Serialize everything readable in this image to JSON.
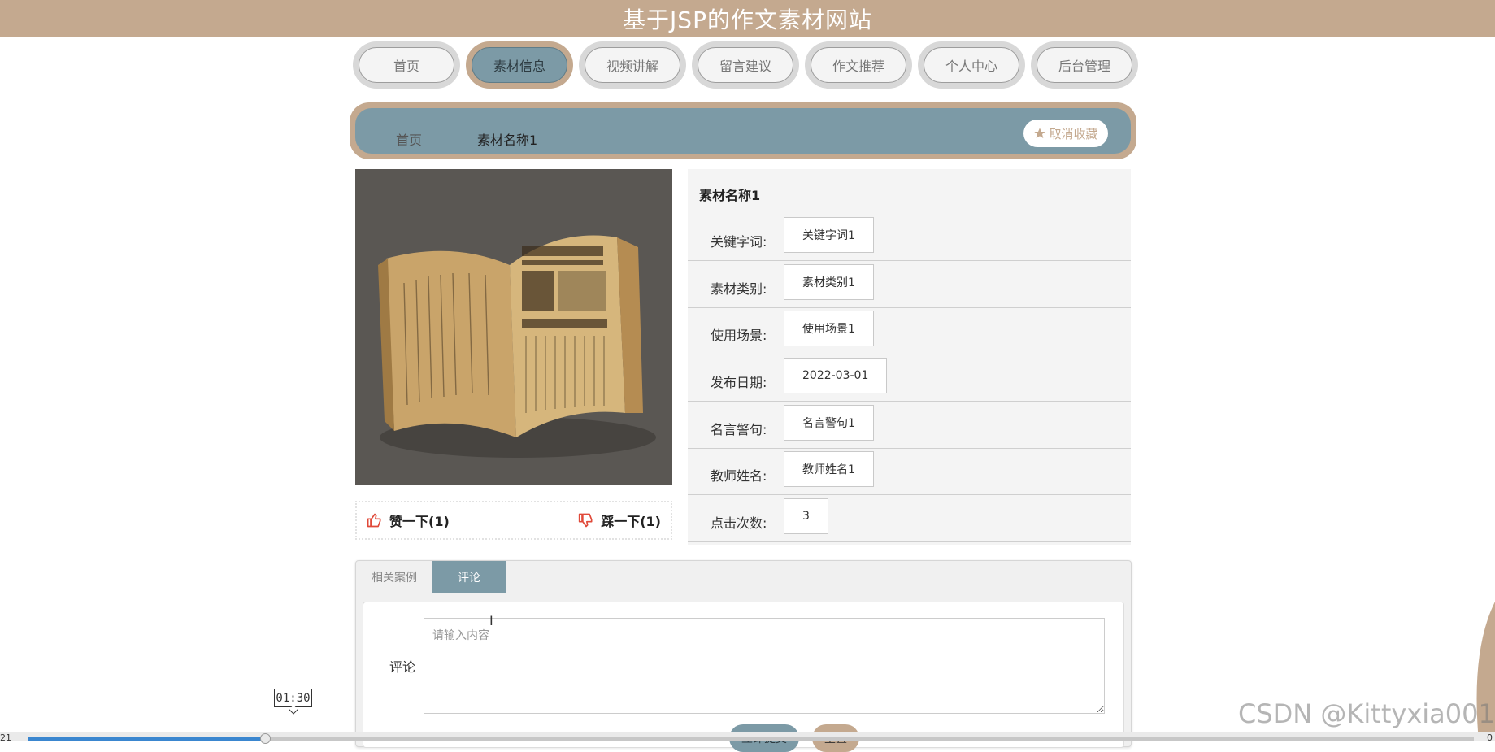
{
  "header": {
    "title": "基于JSP的作文素材网站"
  },
  "nav": {
    "items": [
      {
        "label": "首页",
        "active": false
      },
      {
        "label": "素材信息",
        "active": true
      },
      {
        "label": "视频讲解",
        "active": false
      },
      {
        "label": "留言建议",
        "active": false
      },
      {
        "label": "作文推荐",
        "active": false
      },
      {
        "label": "个人中心",
        "active": false
      },
      {
        "label": "后台管理",
        "active": false
      }
    ]
  },
  "breadcrumb": {
    "home": "首页",
    "current": "素材名称1",
    "favorite_label": "取消收藏",
    "favorite_icon": "star-icon"
  },
  "colors": {
    "brand_tan": "#c4a98f",
    "accent_blue": "#7c9aa6",
    "like_red": "#e04a3a"
  },
  "vote": {
    "like_label": "赞一下(1)",
    "dislike_label": "踩一下(1)"
  },
  "detail": {
    "title": "素材名称1",
    "fields": [
      {
        "label": "关键字词:",
        "value": "关键字词1"
      },
      {
        "label": "素材类别:",
        "value": "素材类别1"
      },
      {
        "label": "使用场景:",
        "value": "使用场景1"
      },
      {
        "label": "发布日期:",
        "value": "2022-03-01"
      },
      {
        "label": "名言警句:",
        "value": "名言警句1"
      },
      {
        "label": "教师姓名:",
        "value": "教师姓名1"
      },
      {
        "label": "点击次数:",
        "value": "3"
      }
    ]
  },
  "tabs": [
    {
      "label": "相关案例",
      "active": false
    },
    {
      "label": "评论",
      "active": true
    }
  ],
  "comment": {
    "label": "评论",
    "placeholder": "请输入内容",
    "submit_label": "立即提交",
    "reset_label": "重置"
  },
  "video": {
    "time_tooltip": "01:30",
    "elapsed_left": "21",
    "right_label": "0",
    "progress": 0.16
  },
  "watermark": "CSDN @Kittyxia001"
}
